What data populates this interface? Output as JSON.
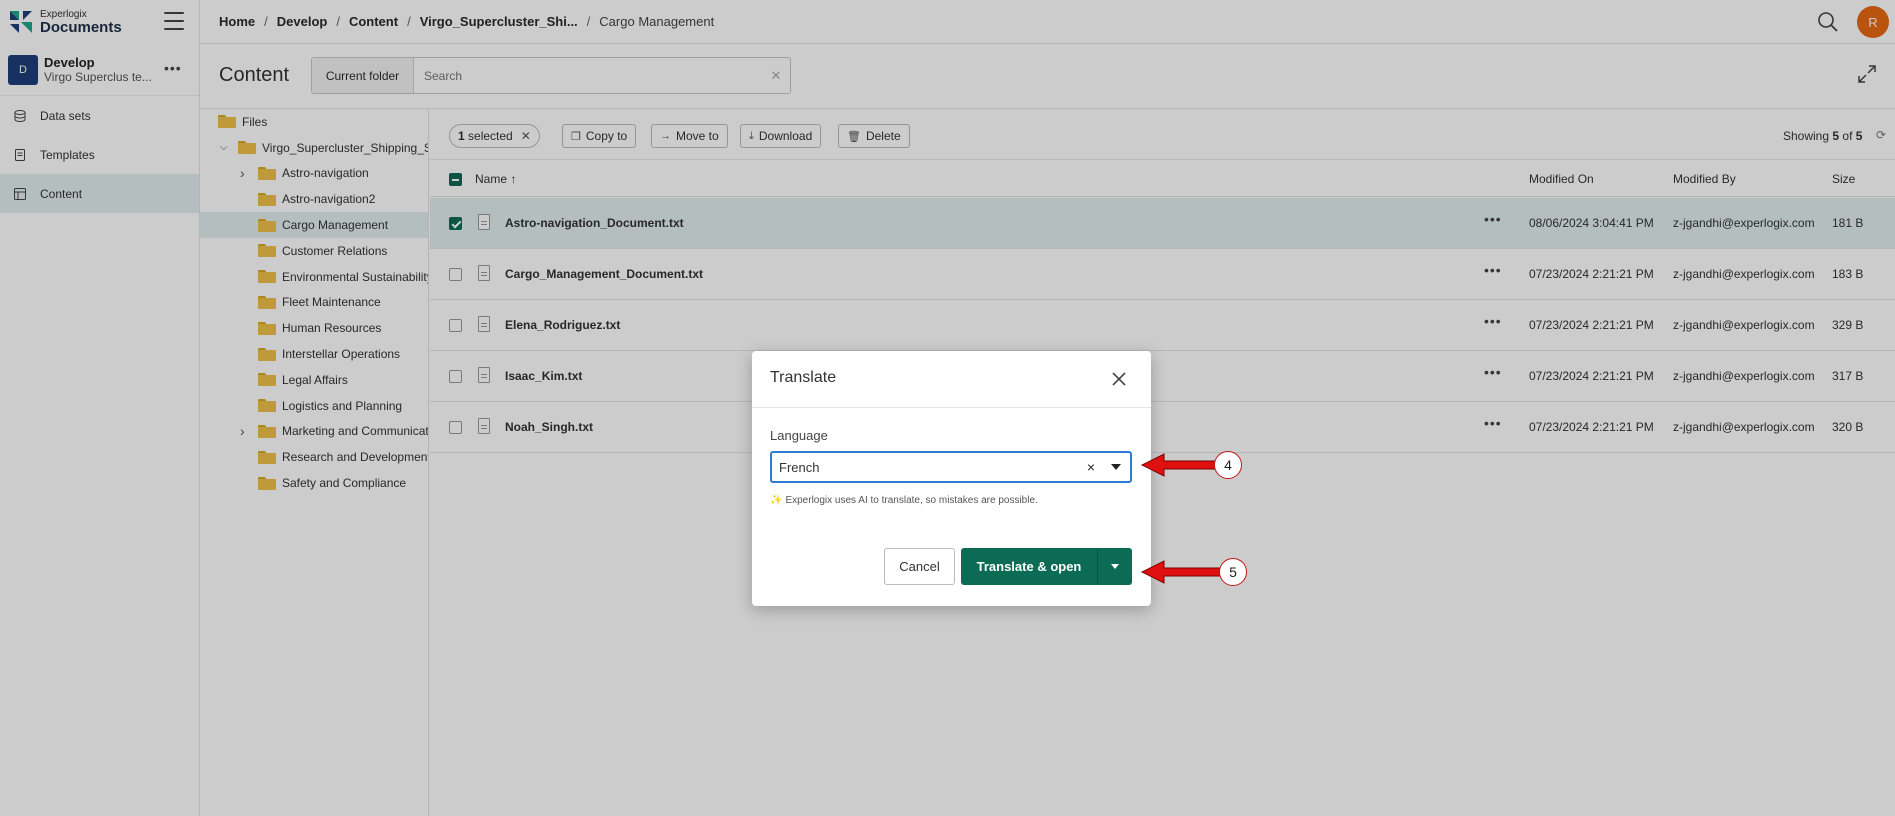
{
  "app": {
    "logo_small": "Experlogix",
    "logo_big": "Documents"
  },
  "workspace": {
    "initial": "D",
    "name": "Develop",
    "subtitle": "Virgo Superclus te..."
  },
  "sidebar": {
    "items": [
      {
        "label": "Data sets",
        "icon": "database-icon",
        "active": false
      },
      {
        "label": "Templates",
        "icon": "document-icon",
        "active": false
      },
      {
        "label": "Content",
        "icon": "content-icon",
        "active": true
      }
    ]
  },
  "breadcrumb": [
    "Home",
    "Develop",
    "Content",
    "Virgo_Supercluster_Shi...",
    "Cargo Management"
  ],
  "user": {
    "initial": "R"
  },
  "content": {
    "title": "Content",
    "scope_label": "Current folder",
    "search_placeholder": "Search"
  },
  "tree": {
    "root": "Files",
    "parent": "Virgo_Supercluster_Shipping_So",
    "folders": [
      {
        "label": "Astro-navigation",
        "expandable": true,
        "selected": false
      },
      {
        "label": "Astro-navigation2",
        "expandable": false,
        "selected": false
      },
      {
        "label": "Cargo Management",
        "expandable": false,
        "selected": true
      },
      {
        "label": "Customer Relations",
        "expandable": false,
        "selected": false
      },
      {
        "label": "Environmental Sustainability",
        "expandable": false,
        "selected": false
      },
      {
        "label": "Fleet Maintenance",
        "expandable": false,
        "selected": false
      },
      {
        "label": "Human Resources",
        "expandable": false,
        "selected": false
      },
      {
        "label": "Interstellar Operations",
        "expandable": false,
        "selected": false
      },
      {
        "label": "Legal Affairs",
        "expandable": false,
        "selected": false
      },
      {
        "label": "Logistics and Planning",
        "expandable": false,
        "selected": false
      },
      {
        "label": "Marketing and Communicat",
        "expandable": true,
        "selected": false
      },
      {
        "label": "Research and Development",
        "expandable": false,
        "selected": false
      },
      {
        "label": "Safety and Compliance",
        "expandable": false,
        "selected": false
      }
    ]
  },
  "toolbar": {
    "selected_count": "1",
    "selected_label": "selected",
    "copy_label": "Copy to",
    "move_label": "Move to",
    "download_label": "Download",
    "delete_label": "Delete",
    "showing_prefix": "Showing",
    "showing_count": "5",
    "showing_of": "of",
    "showing_total": "5"
  },
  "table": {
    "columns": {
      "name": "Name ↑",
      "modified_on": "Modified On",
      "modified_by": "Modified By",
      "size": "Size"
    },
    "rows": [
      {
        "name": "Astro-navigation_Document.txt",
        "modified_on": "08/06/2024 3:04:41 PM",
        "modified_by": "z-jgandhi@experlogix.com",
        "size": "181 B",
        "checked": true
      },
      {
        "name": "Cargo_Management_Document.txt",
        "modified_on": "07/23/2024 2:21:21 PM",
        "modified_by": "z-jgandhi@experlogix.com",
        "size": "183 B",
        "checked": false
      },
      {
        "name": "Elena_Rodriguez.txt",
        "modified_on": "07/23/2024 2:21:21 PM",
        "modified_by": "z-jgandhi@experlogix.com",
        "size": "329 B",
        "checked": false
      },
      {
        "name": "Isaac_Kim.txt",
        "modified_on": "07/23/2024 2:21:21 PM",
        "modified_by": "z-jgandhi@experlogix.com",
        "size": "317 B",
        "checked": false
      },
      {
        "name": "Noah_Singh.txt",
        "modified_on": "07/23/2024 2:21:21 PM",
        "modified_by": "z-jgandhi@experlogix.com",
        "size": "320 B",
        "checked": false
      }
    ]
  },
  "dialog": {
    "title": "Translate",
    "language_label": "Language",
    "language_value": "French",
    "ai_note": "Experlogix uses AI to translate, so mistakes are possible.",
    "cancel_label": "Cancel",
    "primary_label": "Translate & open"
  },
  "annotations": {
    "step_a": "4",
    "step_b": "5",
    "color": "#c21a1a"
  },
  "colors": {
    "accent": "#0c6b54",
    "brand_navy": "#1d3f78",
    "user_orange": "#e76a12",
    "focus_blue": "#2f7bd1"
  }
}
